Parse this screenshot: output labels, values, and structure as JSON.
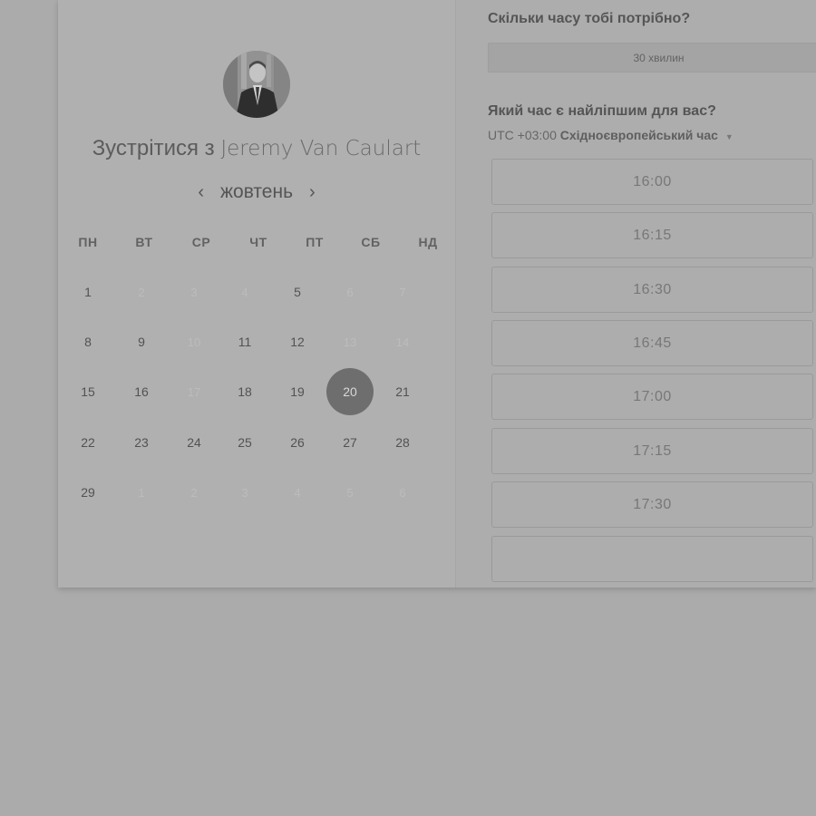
{
  "booking": {
    "title_prefix": "Зустрітися з",
    "host_name": "Jeremy Van Caulart"
  },
  "calendar": {
    "month": "жовтень",
    "weekdays": [
      "ПН",
      "ВТ",
      "СР",
      "ЧТ",
      "ПТ",
      "СБ",
      "НД"
    ],
    "weeks": [
      [
        {
          "d": "1",
          "s": "available"
        },
        {
          "d": "2",
          "s": "muted"
        },
        {
          "d": "3",
          "s": "muted"
        },
        {
          "d": "4",
          "s": "muted"
        },
        {
          "d": "5",
          "s": "available"
        },
        {
          "d": "6",
          "s": "muted"
        },
        {
          "d": "7",
          "s": "muted"
        }
      ],
      [
        {
          "d": "8",
          "s": "available"
        },
        {
          "d": "9",
          "s": "available"
        },
        {
          "d": "10",
          "s": "muted"
        },
        {
          "d": "11",
          "s": "available"
        },
        {
          "d": "12",
          "s": "available"
        },
        {
          "d": "13",
          "s": "muted"
        },
        {
          "d": "14",
          "s": "muted"
        }
      ],
      [
        {
          "d": "15",
          "s": "available"
        },
        {
          "d": "16",
          "s": "available"
        },
        {
          "d": "17",
          "s": "muted"
        },
        {
          "d": "18",
          "s": "available"
        },
        {
          "d": "19",
          "s": "available"
        },
        {
          "d": "20",
          "s": "selected"
        },
        {
          "d": "21",
          "s": "available"
        }
      ],
      [
        {
          "d": "22",
          "s": "available"
        },
        {
          "d": "23",
          "s": "available"
        },
        {
          "d": "24",
          "s": "available"
        },
        {
          "d": "25",
          "s": "available"
        },
        {
          "d": "26",
          "s": "available"
        },
        {
          "d": "27",
          "s": "available"
        },
        {
          "d": "28",
          "s": "available"
        }
      ],
      [
        {
          "d": "29",
          "s": "available"
        },
        {
          "d": "1",
          "s": "muted"
        },
        {
          "d": "2",
          "s": "muted"
        },
        {
          "d": "3",
          "s": "muted"
        },
        {
          "d": "4",
          "s": "muted"
        },
        {
          "d": "5",
          "s": "muted"
        },
        {
          "d": "6",
          "s": "muted"
        }
      ]
    ]
  },
  "duration": {
    "heading": "Скільки часу тобі потрібно?",
    "selected": "30 хвилин"
  },
  "time": {
    "heading": "Який час є найліпшим для вас?",
    "timezone_offset": "UTC +03:00",
    "timezone_name": "Східноєвропейський час",
    "slots": [
      "16:00",
      "16:15",
      "16:30",
      "16:45",
      "17:00",
      "17:15",
      "17:30",
      ""
    ]
  },
  "colors": {
    "selected_day": "#6e6e6e",
    "overlay": "#ababab"
  }
}
